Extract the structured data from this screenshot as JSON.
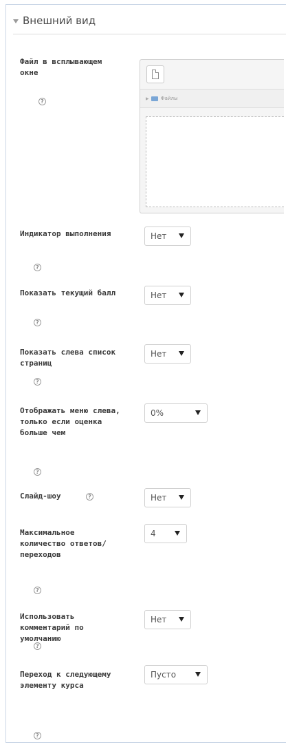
{
  "section": {
    "title": "Внешний вид"
  },
  "filepicker": {
    "path_label": "Файлы"
  },
  "fields": [
    {
      "label": "Файл в всплывающем окне"
    },
    {
      "label": "Индикатор выполнения",
      "value": "Нет"
    },
    {
      "label": "Показать текущий балл",
      "value": "Нет"
    },
    {
      "label": "Показать слева список страниц",
      "value": "Нет"
    },
    {
      "label": "Отображать меню слева, только если оценка больше чем",
      "value": "0%"
    },
    {
      "label": "Слайд-шоу",
      "value": "Нет"
    },
    {
      "label": "Максимальное количество ответов/переходов",
      "value": "4"
    },
    {
      "label": "Использовать комментарий по умолчанию",
      "value": "Нет"
    },
    {
      "label": "Переход к следующему элементу курса",
      "value": "Пусто"
    }
  ],
  "help_glyph": "?"
}
